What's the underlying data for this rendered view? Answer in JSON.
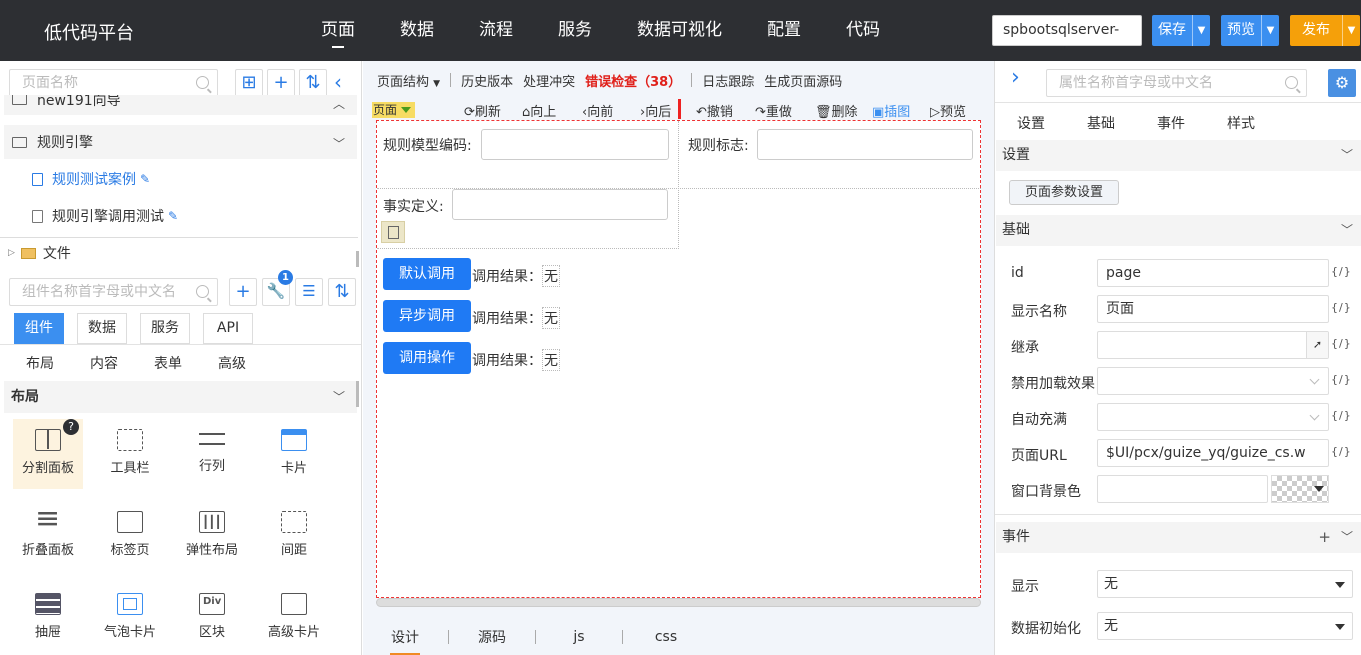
{
  "app": {
    "brand": "低代码平台",
    "nav": [
      "页面",
      "数据",
      "流程",
      "服务",
      "数据可视化",
      "配置",
      "代码"
    ],
    "datasource": "spbootsqlserver-",
    "save": "保存",
    "preview": "预览",
    "publish": "发布",
    "colors": {
      "topbar": "#2d2f33",
      "accent": "#3b8ff0",
      "publish": "#f5a00a",
      "error": "#e0201a"
    }
  },
  "left": {
    "page_search_placeholder": "页面名称",
    "tree": {
      "truncated_group": "new191向导",
      "group": "规则引擎",
      "pages": [
        "规则测试案例",
        "规则引擎调用测试"
      ],
      "files": "文件"
    },
    "component_search_placeholder": "组件名称首字母或中文名",
    "badge_count": "1",
    "tabs": [
      "组件",
      "数据",
      "服务",
      "API"
    ],
    "subtabs": [
      "布局",
      "内容",
      "表单",
      "高级"
    ],
    "section": "布局",
    "components": [
      "分割面板",
      "工具栏",
      "行列",
      "卡片",
      "折叠面板",
      "标签页",
      "弹性布局",
      "间距",
      "抽屉",
      "气泡卡片",
      "区块",
      "高级卡片"
    ]
  },
  "center": {
    "toolbar": {
      "structure": "页面结构",
      "history": "历史版本",
      "conflict": "处理冲突",
      "error_check": "错误检查（38）",
      "log": "日志跟踪",
      "gen_source": "生成页面源码"
    },
    "toolbar2": {
      "page_tag": "页面",
      "refresh": "刷新",
      "up": "向上",
      "forward": "向前",
      "backward": "向后",
      "undo": "撤销",
      "redo": "重做",
      "delete": "删除",
      "insert": "插图",
      "preview": "预览"
    },
    "form": {
      "rule_model_code": "规则模型编码:",
      "rule_flag": "规则标志:",
      "fact_def": "事实定义:"
    },
    "buttons": [
      {
        "label": "默认调用",
        "result_label": "调用结果：",
        "result": "无"
      },
      {
        "label": "异步调用",
        "result_label": "调用结果：",
        "result": "无"
      },
      {
        "label": "调用操作",
        "result_label": "调用结果：",
        "result": "无"
      }
    ],
    "bottom_tabs": [
      "设计",
      "源码",
      "js",
      "css"
    ]
  },
  "right": {
    "search_placeholder": "属性名称首字母或中文名",
    "tabs": [
      "设置",
      "基础",
      "事件",
      "样式"
    ],
    "sections": {
      "settings": "设置",
      "basic": "基础",
      "events": "事件"
    },
    "param_button": "页面参数设置",
    "props": {
      "id_label": "id",
      "id": "page",
      "display_label": "显示名称",
      "display": "页面",
      "inherit_label": "继承",
      "disable_load_label": "禁用加载效果",
      "auto_fill_label": "自动充满",
      "url_label": "页面URL",
      "url": "$UI/pcx/guize_yq/guize_cs.w",
      "bg_label": "窗口背景色"
    },
    "expr": "{/}",
    "events": [
      {
        "label": "显示",
        "value": "无"
      },
      {
        "label": "数据初始化",
        "value": "无"
      }
    ]
  }
}
